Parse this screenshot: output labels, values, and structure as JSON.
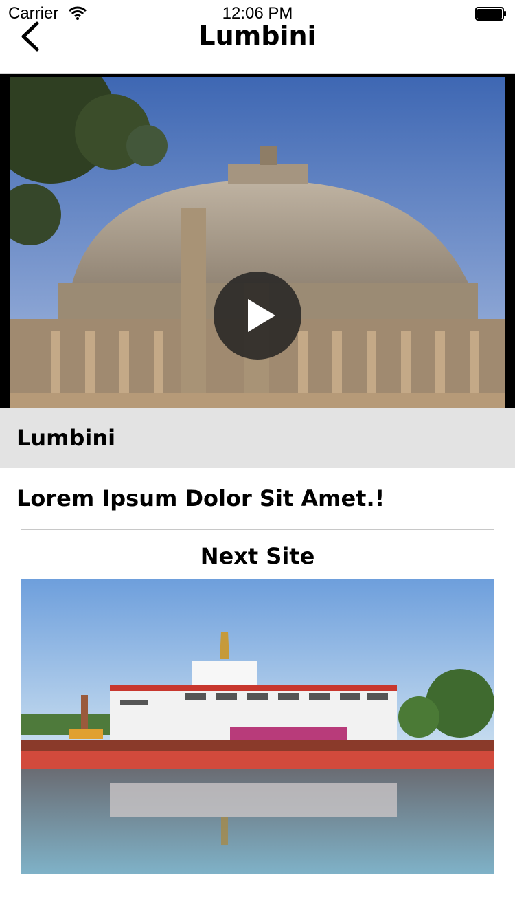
{
  "status_bar": {
    "carrier": "Carrier",
    "time": "12:06 PM"
  },
  "nav": {
    "title": "Lumbini"
  },
  "caption": {
    "title": "Lumbini"
  },
  "description": "Lorem Ipsum Dolor Sit Amet.!",
  "next_site": {
    "label": "Next Site"
  },
  "icons": {
    "back": "chevron-left-icon",
    "play": "play-icon",
    "wifi": "wifi-icon",
    "battery": "battery-icon"
  }
}
